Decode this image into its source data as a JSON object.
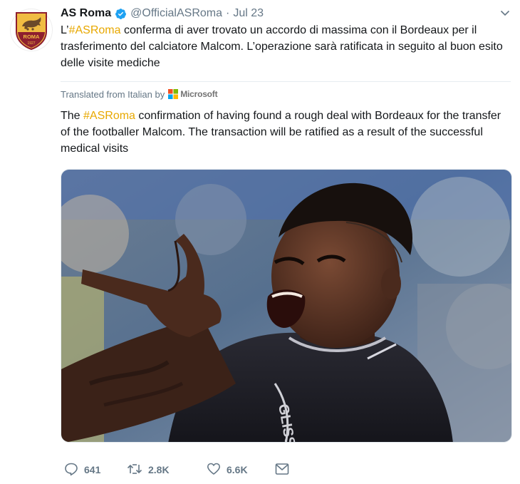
{
  "tweet": {
    "author_name": "AS Roma",
    "handle": "@OfficialASRoma",
    "separator": "·",
    "date": "Jul 23",
    "text_prefix": "L’",
    "hashtag": "#ASRoma",
    "text_rest": " conferma di aver trovato un accordo di massima con il Bordeaux per il trasferimento del calciatore Malcom. L’operazione sarà ratificata in seguito al buon esito delle visite mediche",
    "translated_from": "Translated from Italian by",
    "translator": "Microsoft",
    "translation_prefix": "The ",
    "translation_hashtag": "#ASRoma",
    "translation_rest": " confirmation of having found a rough deal with Bordeaux for the transfer of the footballer Malcom. The transaction will be ratified as a result of the successful medical  visits"
  },
  "actions": {
    "replies": "641",
    "retweets": "2.8K",
    "likes": "6.6K"
  },
  "avatar": {
    "badge_text": "ROMA",
    "year": "1927"
  },
  "colors": {
    "hashtag": "#e8a800",
    "secondary_text": "#657786",
    "verified": "#1da1f2",
    "roma_red": "#8e1f2f",
    "roma_gold": "#f0bc42"
  },
  "icons": {
    "verified": "verified-badge-icon",
    "caret": "chevron-down-icon",
    "reply": "reply-icon",
    "retweet": "retweet-icon",
    "like": "heart-icon",
    "dm": "envelope-icon",
    "microsoft": "microsoft-logo-icon"
  }
}
